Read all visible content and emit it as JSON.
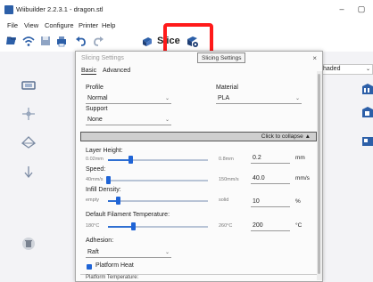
{
  "window": {
    "title": "Wiibuilder 2.2.3.1 - dragon.stl",
    "minimize_glyph": "–",
    "maximize_glyph": "▢"
  },
  "menu": [
    "File",
    "View",
    "Configure",
    "Printer",
    "Help"
  ],
  "toolbar": {
    "icons": [
      "open-icon",
      "wifi-icon",
      "save-icon",
      "print-icon",
      "undo-icon",
      "redo-icon"
    ],
    "slice_label": "Slice",
    "slice_settings_icon": "slice-settings-icon"
  },
  "view_mode": {
    "value": "haded"
  },
  "left_tools": [
    "move-tool-icon",
    "crosshair-icon",
    "rotate-icon",
    "down-arrow-icon",
    "delete-icon"
  ],
  "right_tools": [
    "view-front-icon",
    "view-side-icon",
    "view-top-icon"
  ],
  "dialog": {
    "title": "Slicing Settings",
    "tooltip": "Slicing Settings",
    "close_glyph": "×",
    "tabs": [
      "Basic",
      "Advanced"
    ],
    "profile": {
      "label": "Profile",
      "value": "Normal"
    },
    "material": {
      "label": "Material",
      "value": "PLA"
    },
    "support": {
      "label": "Support",
      "value": "None"
    },
    "collapse_label": "Click to collapse ▲",
    "layer_height": {
      "label": "Layer Height:",
      "min": "0.02mm",
      "max": "0.8mm",
      "value": "0.2",
      "unit": "mm",
      "fraction": 0.22
    },
    "speed": {
      "label": "Speed:",
      "min": "40mm/s",
      "max": "150mm/s",
      "value": "40.0",
      "unit": "mm/s",
      "fraction": 0.0
    },
    "infill": {
      "label": "Infill Density:",
      "min": "empty",
      "max": "solid",
      "value": "10",
      "unit": "%",
      "fraction": 0.1
    },
    "filament_temp": {
      "label": "Default Filament Temperature:",
      "min": "180°C",
      "max": "260°C",
      "value": "200",
      "unit": "°C",
      "fraction": 0.25
    },
    "adhesion": {
      "label": "Adhesion:",
      "value": "Raft"
    },
    "platform_heat": {
      "label": "Platform Heat",
      "checked": true
    },
    "platform_temp_label": "Platform Temperature:"
  }
}
